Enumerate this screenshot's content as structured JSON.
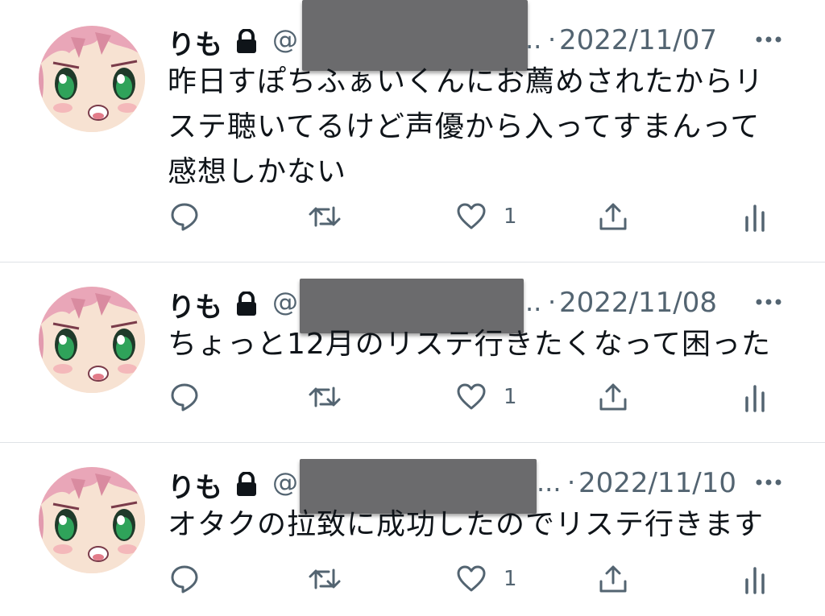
{
  "tweets": [
    {
      "name": "りも",
      "handle_prefix": "@",
      "truncation": "..",
      "date_sep": "·",
      "date": "2022/11/07",
      "text_lines": [
        "昨日すぽちふぁいくんにお薦めされたからリ",
        "ステ聴いてるけど声優から入ってすまんって",
        "感想しかない"
      ],
      "like_count": "1"
    },
    {
      "name": "りも",
      "handle_prefix": "@",
      "truncation": "..",
      "date_sep": "·",
      "date": "2022/11/08",
      "text_lines": [
        "ちょっと12月のリステ行きたくなって困った"
      ],
      "like_count": "1"
    },
    {
      "name": "りも",
      "handle_prefix": "@",
      "truncation": "...",
      "date_sep": "·",
      "date": "2022/11/10",
      "text_lines": [
        "オタクの拉致に成功したのでリステ行きます"
      ],
      "like_count": "1"
    }
  ],
  "icons": {
    "lock": "lock-icon",
    "more": "more-icon",
    "reply": "reply-icon",
    "retweet": "retweet-icon",
    "like": "heart-icon",
    "share": "share-icon",
    "analytics": "analytics-icon"
  },
  "colors": {
    "text": "#0f1419",
    "secondary": "#536471",
    "redaction": "#6b6b6d",
    "divider": "#dfe3e6"
  }
}
